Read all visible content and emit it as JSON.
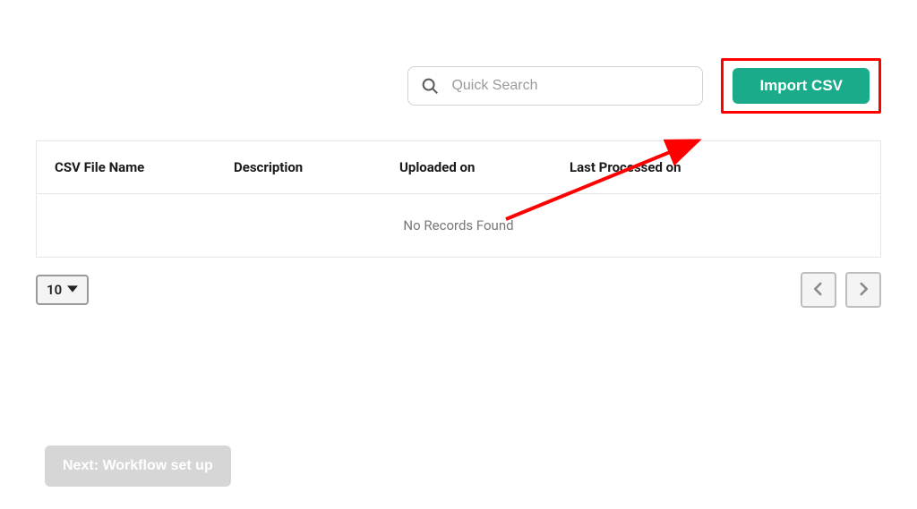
{
  "search": {
    "placeholder": "Quick Search"
  },
  "buttons": {
    "import": "Import CSV",
    "next_step": "Next: Workflow set up"
  },
  "table": {
    "headers": {
      "file_name": "CSV File Name",
      "description": "Description",
      "uploaded": "Uploaded on",
      "processed": "Last Processed on"
    },
    "empty_message": "No Records Found"
  },
  "pagination": {
    "page_size": "10"
  }
}
